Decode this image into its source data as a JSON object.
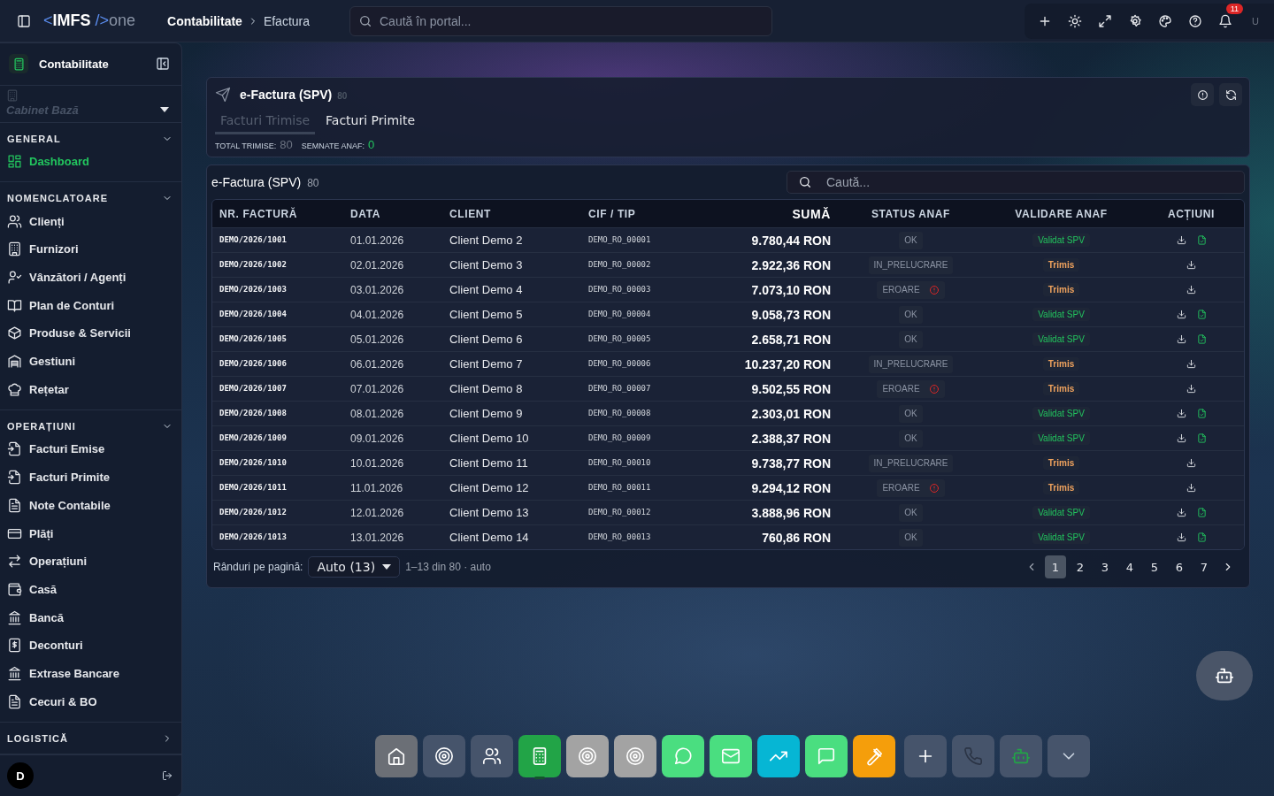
{
  "topbar": {
    "logo": {
      "open": "<",
      "name": "IMFS",
      "close": "/>",
      "suffix": "one"
    },
    "breadcrumb": [
      "Contabilitate",
      "Efactura"
    ],
    "search": {
      "placeholder": "Caută în portal..."
    },
    "notifications": "11",
    "user": "U"
  },
  "sidebar": {
    "module": "Contabilitate",
    "workspace": "Cabinet Bază",
    "sections": [
      {
        "title": "GENERAL",
        "expanded": true,
        "items": [
          {
            "label": "Dashboard",
            "selected": true
          }
        ]
      },
      {
        "title": "NOMENCLATOARE",
        "expanded": true,
        "items": [
          {
            "label": "Clienți",
            "selected": false
          },
          {
            "label": "Furnizori",
            "selected": false
          },
          {
            "label": "Vânzători / Agenți",
            "selected": false
          },
          {
            "label": "Plan de Conturi",
            "selected": false
          },
          {
            "label": "Produse & Servicii",
            "selected": false
          },
          {
            "label": "Gestiuni",
            "selected": false
          },
          {
            "label": "Rețetar",
            "selected": false
          }
        ]
      },
      {
        "title": "OPERAȚIUNI",
        "expanded": true,
        "items": [
          {
            "label": "Facturi Emise",
            "selected": false
          },
          {
            "label": "Facturi Primite",
            "selected": false
          },
          {
            "label": "Note Contabile",
            "selected": false
          },
          {
            "label": "Plăți",
            "selected": false
          },
          {
            "label": "Operațiuni",
            "selected": false
          },
          {
            "label": "Casă",
            "selected": false
          },
          {
            "label": "Bancă",
            "selected": false
          },
          {
            "label": "Deconturi",
            "selected": false
          },
          {
            "label": "Extrase Bancare",
            "selected": false
          },
          {
            "label": "Cecuri & BO",
            "selected": false
          }
        ]
      },
      {
        "title": "LOGISTICĂ",
        "expanded": false
      }
    ],
    "avatar": "D"
  },
  "header_card": {
    "title": "e-Factura (SPV)",
    "count": "80",
    "tabs": [
      {
        "label": "Facturi Trimise",
        "selected": true
      },
      {
        "label": "Facturi Primite",
        "selected": false
      }
    ],
    "stats": [
      {
        "label": "TOTAL TRIMISE:",
        "value": "80",
        "color": "#6b7280"
      },
      {
        "label": "SEMNATE ANAF:",
        "value": "0",
        "color": "#22c55e"
      }
    ]
  },
  "table": {
    "title": "e-Factura (SPV)",
    "count": "80",
    "search": {
      "placeholder": "Caută..."
    },
    "columns": [
      "NR. FACTURĂ",
      "DATA",
      "CLIENT",
      "CIF / TIP",
      "SUMĂ",
      "STATUS ANAF",
      "VALIDARE ANAF",
      "ACȚIUNI"
    ],
    "rows": [
      {
        "number": "DEMO/2026/1001",
        "date": "01.01.2026",
        "client": "Client Demo 2",
        "cif": "DEMO_RO_00001",
        "amount": "9.780,44 RON",
        "status": {
          "text": "OK",
          "kind": "ok"
        },
        "validation": {
          "text": "Validat SPV",
          "kind": "validated"
        },
        "has_document": true
      },
      {
        "number": "DEMO/2026/1002",
        "date": "02.01.2026",
        "client": "Client Demo 3",
        "cif": "DEMO_RO_00002",
        "amount": "2.922,36 RON",
        "status": {
          "text": "IN_PRELUCRARE",
          "kind": "processing"
        },
        "validation": {
          "text": "Trimis",
          "kind": "sent"
        },
        "has_document": false
      },
      {
        "number": "DEMO/2026/1003",
        "date": "03.01.2026",
        "client": "Client Demo 4",
        "cif": "DEMO_RO_00003",
        "amount": "7.073,10 RON",
        "status": {
          "text": "EROARE",
          "kind": "error"
        },
        "validation": {
          "text": "Trimis",
          "kind": "sent"
        },
        "has_document": false
      },
      {
        "number": "DEMO/2026/1004",
        "date": "04.01.2026",
        "client": "Client Demo 5",
        "cif": "DEMO_RO_00004",
        "amount": "9.058,73 RON",
        "status": {
          "text": "OK",
          "kind": "ok"
        },
        "validation": {
          "text": "Validat SPV",
          "kind": "validated"
        },
        "has_document": true
      },
      {
        "number": "DEMO/2026/1005",
        "date": "05.01.2026",
        "client": "Client Demo 6",
        "cif": "DEMO_RO_00005",
        "amount": "2.658,71 RON",
        "status": {
          "text": "OK",
          "kind": "ok"
        },
        "validation": {
          "text": "Validat SPV",
          "kind": "validated"
        },
        "has_document": true
      },
      {
        "number": "DEMO/2026/1006",
        "date": "06.01.2026",
        "client": "Client Demo 7",
        "cif": "DEMO_RO_00006",
        "amount": "10.237,20 RON",
        "status": {
          "text": "IN_PRELUCRARE",
          "kind": "processing"
        },
        "validation": {
          "text": "Trimis",
          "kind": "sent"
        },
        "has_document": false
      },
      {
        "number": "DEMO/2026/1007",
        "date": "07.01.2026",
        "client": "Client Demo 8",
        "cif": "DEMO_RO_00007",
        "amount": "9.502,55 RON",
        "status": {
          "text": "EROARE",
          "kind": "error"
        },
        "validation": {
          "text": "Trimis",
          "kind": "sent"
        },
        "has_document": false
      },
      {
        "number": "DEMO/2026/1008",
        "date": "08.01.2026",
        "client": "Client Demo 9",
        "cif": "DEMO_RO_00008",
        "amount": "2.303,01 RON",
        "status": {
          "text": "OK",
          "kind": "ok"
        },
        "validation": {
          "text": "Validat SPV",
          "kind": "validated"
        },
        "has_document": true
      },
      {
        "number": "DEMO/2026/1009",
        "date": "09.01.2026",
        "client": "Client Demo 10",
        "cif": "DEMO_RO_00009",
        "amount": "2.388,37 RON",
        "status": {
          "text": "OK",
          "kind": "ok"
        },
        "validation": {
          "text": "Validat SPV",
          "kind": "validated"
        },
        "has_document": true
      },
      {
        "number": "DEMO/2026/1010",
        "date": "10.01.2026",
        "client": "Client Demo 11",
        "cif": "DEMO_RO_00010",
        "amount": "9.738,77 RON",
        "status": {
          "text": "IN_PRELUCRARE",
          "kind": "processing"
        },
        "validation": {
          "text": "Trimis",
          "kind": "sent"
        },
        "has_document": false
      },
      {
        "number": "DEMO/2026/1011",
        "date": "11.01.2026",
        "client": "Client Demo 12",
        "cif": "DEMO_RO_00011",
        "amount": "9.294,12 RON",
        "status": {
          "text": "EROARE",
          "kind": "error"
        },
        "validation": {
          "text": "Trimis",
          "kind": "sent"
        },
        "has_document": false
      },
      {
        "number": "DEMO/2026/1012",
        "date": "12.01.2026",
        "client": "Client Demo 13",
        "cif": "DEMO_RO_00012",
        "amount": "3.888,96 RON",
        "status": {
          "text": "OK",
          "kind": "ok"
        },
        "validation": {
          "text": "Validat SPV",
          "kind": "validated"
        },
        "has_document": true
      },
      {
        "number": "DEMO/2026/1013",
        "date": "13.01.2026",
        "client": "Client Demo 14",
        "cif": "DEMO_RO_00013",
        "amount": "760,86 RON",
        "status": {
          "text": "OK",
          "kind": "ok"
        },
        "validation": {
          "text": "Validat SPV",
          "kind": "validated"
        },
        "has_document": true
      }
    ],
    "pagination": {
      "label": "Rânduri pe pagină:",
      "page_size": "Auto (13)",
      "range": "1–13 din 80 · auto",
      "pages": [
        {
          "label": "1",
          "selected": true
        },
        {
          "label": "2",
          "selected": false
        },
        {
          "label": "3",
          "selected": false
        },
        {
          "label": "4",
          "selected": false
        },
        {
          "label": "5",
          "selected": false
        },
        {
          "label": "6",
          "selected": false
        },
        {
          "label": "7",
          "selected": false
        }
      ]
    }
  },
  "dock": [
    {
      "kind": "home",
      "color": "#6b6f76",
      "selected": false
    },
    {
      "kind": "target",
      "color": "#46546b",
      "selected": false
    },
    {
      "kind": "users",
      "color": "#46546b",
      "selected": false
    },
    {
      "kind": "calculator",
      "color": "#22a447",
      "selected": true
    },
    {
      "kind": "target",
      "color": "#a3a3a3",
      "selected": false
    },
    {
      "kind": "target",
      "color": "#a3a3a3",
      "selected": false
    },
    {
      "kind": "whatsapp",
      "color": "#4ade80",
      "selected": false
    },
    {
      "kind": "mail",
      "color": "#4ade80",
      "selected": false
    },
    {
      "kind": "trend",
      "color": "#06b6d4",
      "selected": false
    },
    {
      "kind": "chat",
      "color": "#4ade80",
      "selected": false
    },
    {
      "kind": "hammer",
      "color": "#f59e0b",
      "selected": false
    },
    {
      "kind": "plus",
      "color": "#46546b",
      "selected": false
    },
    {
      "kind": "phone",
      "color": "#46546b",
      "selected": false
    },
    {
      "kind": "bot",
      "color": "#46546b",
      "selected": false
    },
    {
      "kind": "chevron",
      "color": "#46546b",
      "selected": false
    }
  ]
}
